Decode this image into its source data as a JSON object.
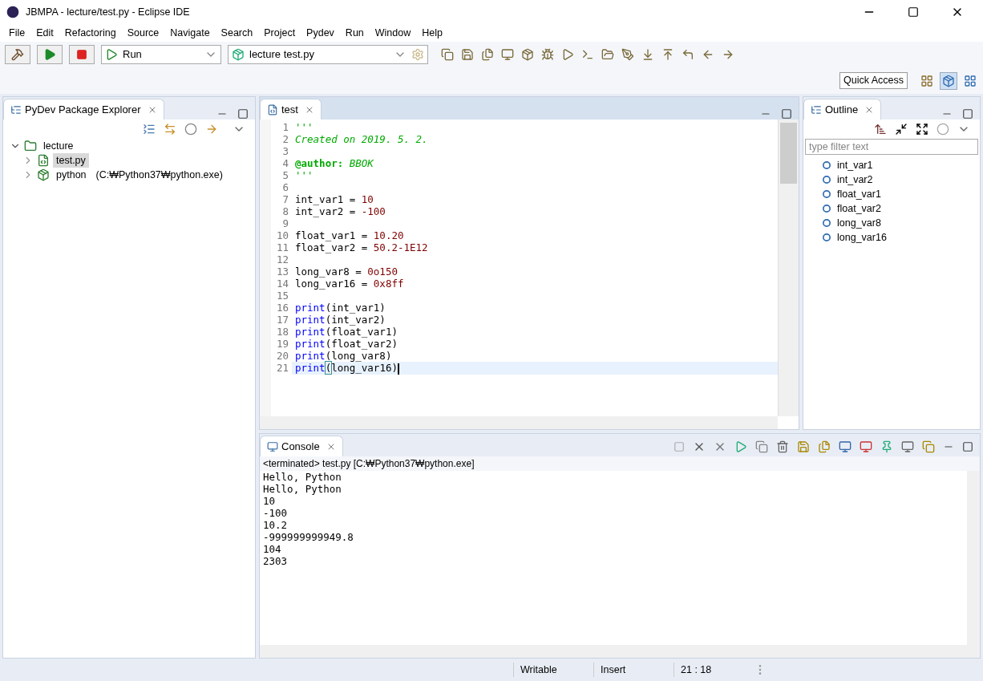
{
  "window": {
    "title": "JBMPA - lecture/test.py - Eclipse IDE"
  },
  "menu": [
    "File",
    "Edit",
    "Refactoring",
    "Source",
    "Navigate",
    "Search",
    "Project",
    "Pydev",
    "Run",
    "Window",
    "Help"
  ],
  "toolbar": {
    "run_config": "Run",
    "launch_target": "lecture test.py",
    "quick_access": "Quick Access"
  },
  "explorer": {
    "title": "PyDev Package Explorer",
    "tree": [
      {
        "label": "lecture",
        "kind": "project",
        "expanded": true,
        "selected": false,
        "children": [
          {
            "label": "test.py",
            "kind": "file",
            "expanded": false,
            "selected": true
          },
          {
            "label": "python",
            "detail": "(C:₩Python37₩python.exe)",
            "kind": "interpreter",
            "expanded": false,
            "selected": false
          }
        ]
      }
    ]
  },
  "editor": {
    "tab": "test",
    "lines": [
      {
        "number": "1",
        "current": false,
        "tokens": [
          {
            "kind": "comment",
            "text": "'''"
          }
        ]
      },
      {
        "number": "2",
        "current": false,
        "tokens": [
          {
            "kind": "comment",
            "text": "Created on 2019. 5. 2."
          }
        ]
      },
      {
        "number": "3",
        "current": false
      },
      {
        "number": "4",
        "current": false,
        "tokens": [
          {
            "kind": "decorator",
            "text": "@author:"
          },
          {
            "kind": "comment",
            "text": " BBOK"
          }
        ]
      },
      {
        "number": "5",
        "current": false,
        "tokens": [
          {
            "kind": "comment",
            "text": "'''"
          }
        ]
      },
      {
        "number": "6",
        "current": false
      },
      {
        "number": "7",
        "current": false,
        "tokens": [
          {
            "kind": "plain",
            "text": "int_var1 = "
          },
          {
            "kind": "number",
            "text": "10"
          }
        ]
      },
      {
        "number": "8",
        "current": false,
        "tokens": [
          {
            "kind": "plain",
            "text": "int_var2 = "
          },
          {
            "kind": "number",
            "text": "-100"
          }
        ]
      },
      {
        "number": "9",
        "current": false
      },
      {
        "number": "10",
        "current": false,
        "tokens": [
          {
            "kind": "plain",
            "text": "float_var1 = "
          },
          {
            "kind": "number",
            "text": "10.20"
          }
        ]
      },
      {
        "number": "11",
        "current": false,
        "tokens": [
          {
            "kind": "plain",
            "text": "float_var2 = "
          },
          {
            "kind": "number",
            "text": "50.2-1E12"
          }
        ]
      },
      {
        "number": "12",
        "current": false
      },
      {
        "number": "13",
        "current": false,
        "tokens": [
          {
            "kind": "plain",
            "text": "long_var8 = "
          },
          {
            "kind": "number",
            "text": "0o150"
          }
        ]
      },
      {
        "number": "14",
        "current": false,
        "tokens": [
          {
            "kind": "plain",
            "text": "long_var16 = "
          },
          {
            "kind": "number",
            "text": "0x8ff"
          }
        ]
      },
      {
        "number": "15",
        "current": false
      },
      {
        "number": "16",
        "current": false,
        "tokens": [
          {
            "kind": "keyword",
            "text": "print"
          },
          {
            "kind": "plain",
            "text": "(int_var1)"
          }
        ]
      },
      {
        "number": "17",
        "current": false,
        "tokens": [
          {
            "kind": "keyword",
            "text": "print"
          },
          {
            "kind": "plain",
            "text": "(int_var2)"
          }
        ]
      },
      {
        "number": "18",
        "current": false,
        "tokens": [
          {
            "kind": "keyword",
            "text": "print"
          },
          {
            "kind": "plain",
            "text": "(float_var1)"
          }
        ]
      },
      {
        "number": "19",
        "current": false,
        "tokens": [
          {
            "kind": "keyword",
            "text": "print"
          },
          {
            "kind": "plain",
            "text": "(float_var2)"
          }
        ]
      },
      {
        "number": "20",
        "current": false,
        "tokens": [
          {
            "kind": "keyword",
            "text": "print"
          },
          {
            "kind": "plain",
            "text": "(long_var8)"
          }
        ]
      },
      {
        "number": "21",
        "current": true,
        "tokens": [
          {
            "kind": "keyword",
            "text": "print"
          },
          {
            "kind": "match",
            "text": "("
          },
          {
            "kind": "plain",
            "text": "long_var16)"
          }
        ]
      }
    ]
  },
  "outline": {
    "title": "Outline",
    "filter_placeholder": "type filter text",
    "items": [
      "int_var1",
      "int_var2",
      "float_var1",
      "float_var2",
      "long_var8",
      "long_var16"
    ]
  },
  "console": {
    "title": "Console",
    "status": "<terminated> test.py [C:₩Python37₩python.exe]",
    "output": [
      "Hello, Python",
      "Hello, Python",
      "10",
      "-100",
      "10.2",
      "-999999999949.8",
      "104",
      "2303"
    ]
  },
  "status_bar": {
    "mode": "Writable",
    "insert": "Insert",
    "position": "21 : 18"
  }
}
